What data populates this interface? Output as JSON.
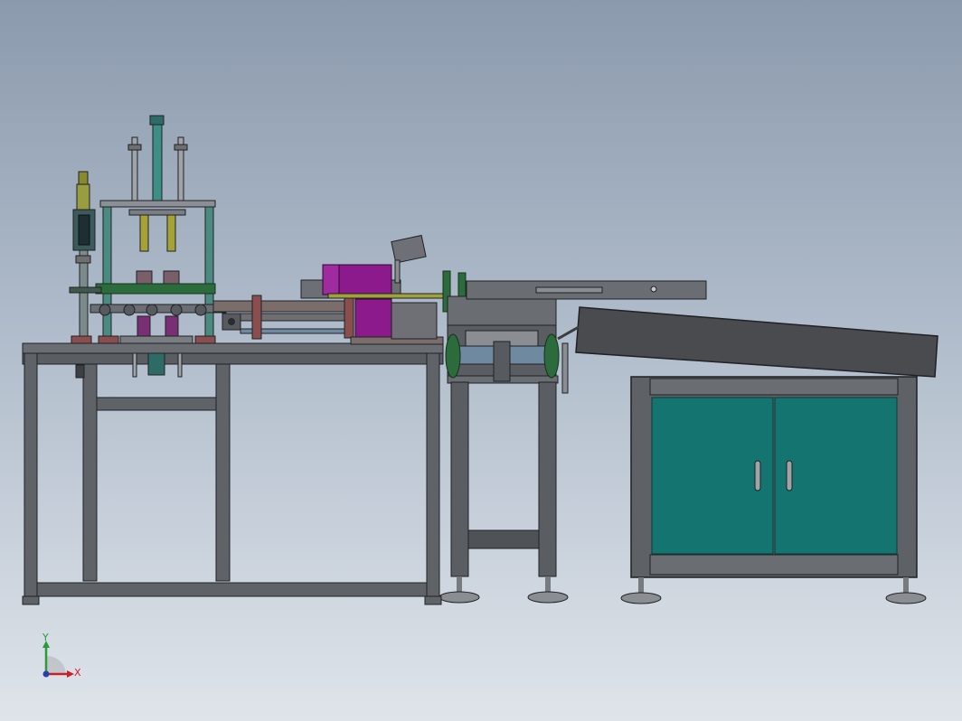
{
  "viewport": {
    "background_top": "#8b9aad",
    "background_bottom": "#dfe4ea"
  },
  "colors": {
    "frame": "#5b5e63",
    "frame_edge": "#2a2c30",
    "cabinet_door": "#137470",
    "motor": "#8c1a8c",
    "rollers": "#7a5e6a",
    "green_parts": "#2c6b3c",
    "cylinders": "#8a8a2c",
    "teal_rod": "#3d8f86",
    "conveyor_belt": "#4a4b4e"
  },
  "triad": {
    "x_label": "X",
    "y_label": "Y",
    "x_color": "#c8202a",
    "y_color": "#2c9a3a",
    "z_color": "#2a3fae"
  }
}
